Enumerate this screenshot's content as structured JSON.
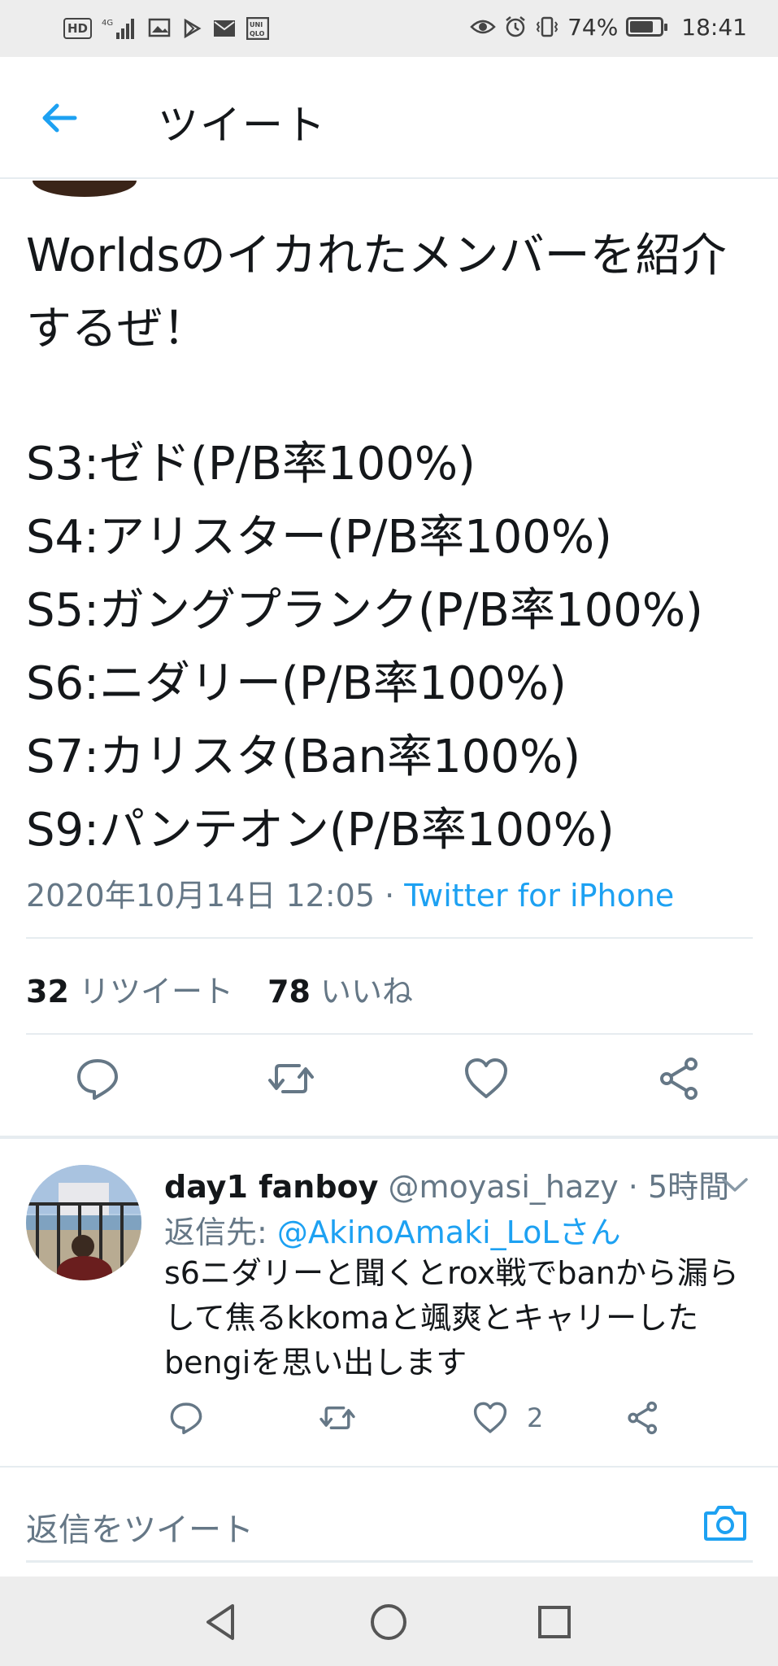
{
  "status_bar": {
    "left_indicators": [
      "HD",
      "4G",
      "UNI QLO"
    ],
    "battery": "74%",
    "battery_level": 0.74,
    "time": "18:41"
  },
  "header": {
    "title": "ツイート",
    "back_icon": "arrow-left-icon"
  },
  "tweet": {
    "text_intro": "Worldsのイカれたメンバーを紹介\nするぜ！",
    "lines": [
      "S3:ゼド(P/B率100%)",
      "S4:アリスター(P/B率100%)",
      "S5:ガングプランク(P/B率100%)",
      "S6:ニダリー(P/B率100%)",
      "S7:カリスタ(Ban率100%)",
      "S9:パンテオン(P/B率100%)"
    ],
    "timestamp": "2020年10月14日 12:05 · ",
    "source": "Twitter for iPhone",
    "retweets_count": "32",
    "retweets_label": " リツイート",
    "likes_count": "78",
    "likes_label": " いいね"
  },
  "reply": {
    "name": "day1 fanboy",
    "handle_time": " @moyasi_hazy · 5時間",
    "to_label": "返信先: ",
    "to_mention": "@AkinoAmaki_LoLさん",
    "text": "s6ニダリーと聞くとrox戦でbanから漏らして焦るkkomaと颯爽とキャリーしたbengiを思い出します",
    "like_count": "2"
  },
  "compose": {
    "placeholder": "返信をツイート"
  },
  "colors": {
    "accent": "#1da1f2",
    "text": "#14171a",
    "secondary": "#657786",
    "icon_gray": "#657786"
  }
}
